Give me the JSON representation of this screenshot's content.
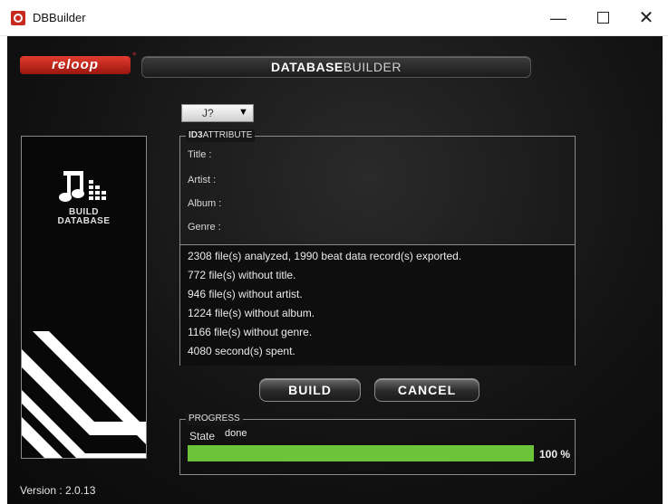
{
  "window": {
    "title": "DBBuilder",
    "minimize": "—",
    "maximize": "",
    "close": "✕"
  },
  "header": {
    "logo": "reloop",
    "logo_mark": "°",
    "title_bold": "DATABASE",
    "title_light": "BUILDER"
  },
  "left_panel": {
    "label_line1": "BUILD",
    "label_line2": "DATABASE"
  },
  "version": "Version : 2.0.13",
  "language_select": {
    "value": "J?",
    "arrow": "▼"
  },
  "id3": {
    "legend_bold": "ID3",
    "legend_rest": "ATTRIBUTE",
    "fields": [
      "Title :",
      "Artist :",
      "Album :",
      "Genre :"
    ]
  },
  "report": [
    "2308 file(s) analyzed, 1990 beat data record(s) exported.",
    "772 file(s) without title.",
    "946 file(s) without artist.",
    "1224 file(s) without album.",
    "1166 file(s) without genre.",
    "4080 second(s) spent."
  ],
  "buttons": {
    "build": "BUILD",
    "cancel": "CANCEL"
  },
  "progress": {
    "legend": "PROGRESS",
    "state_label": "State",
    "state_value": "done",
    "percent_value": 100,
    "percent_text": "100 %",
    "fill_color": "#6cc43a"
  }
}
